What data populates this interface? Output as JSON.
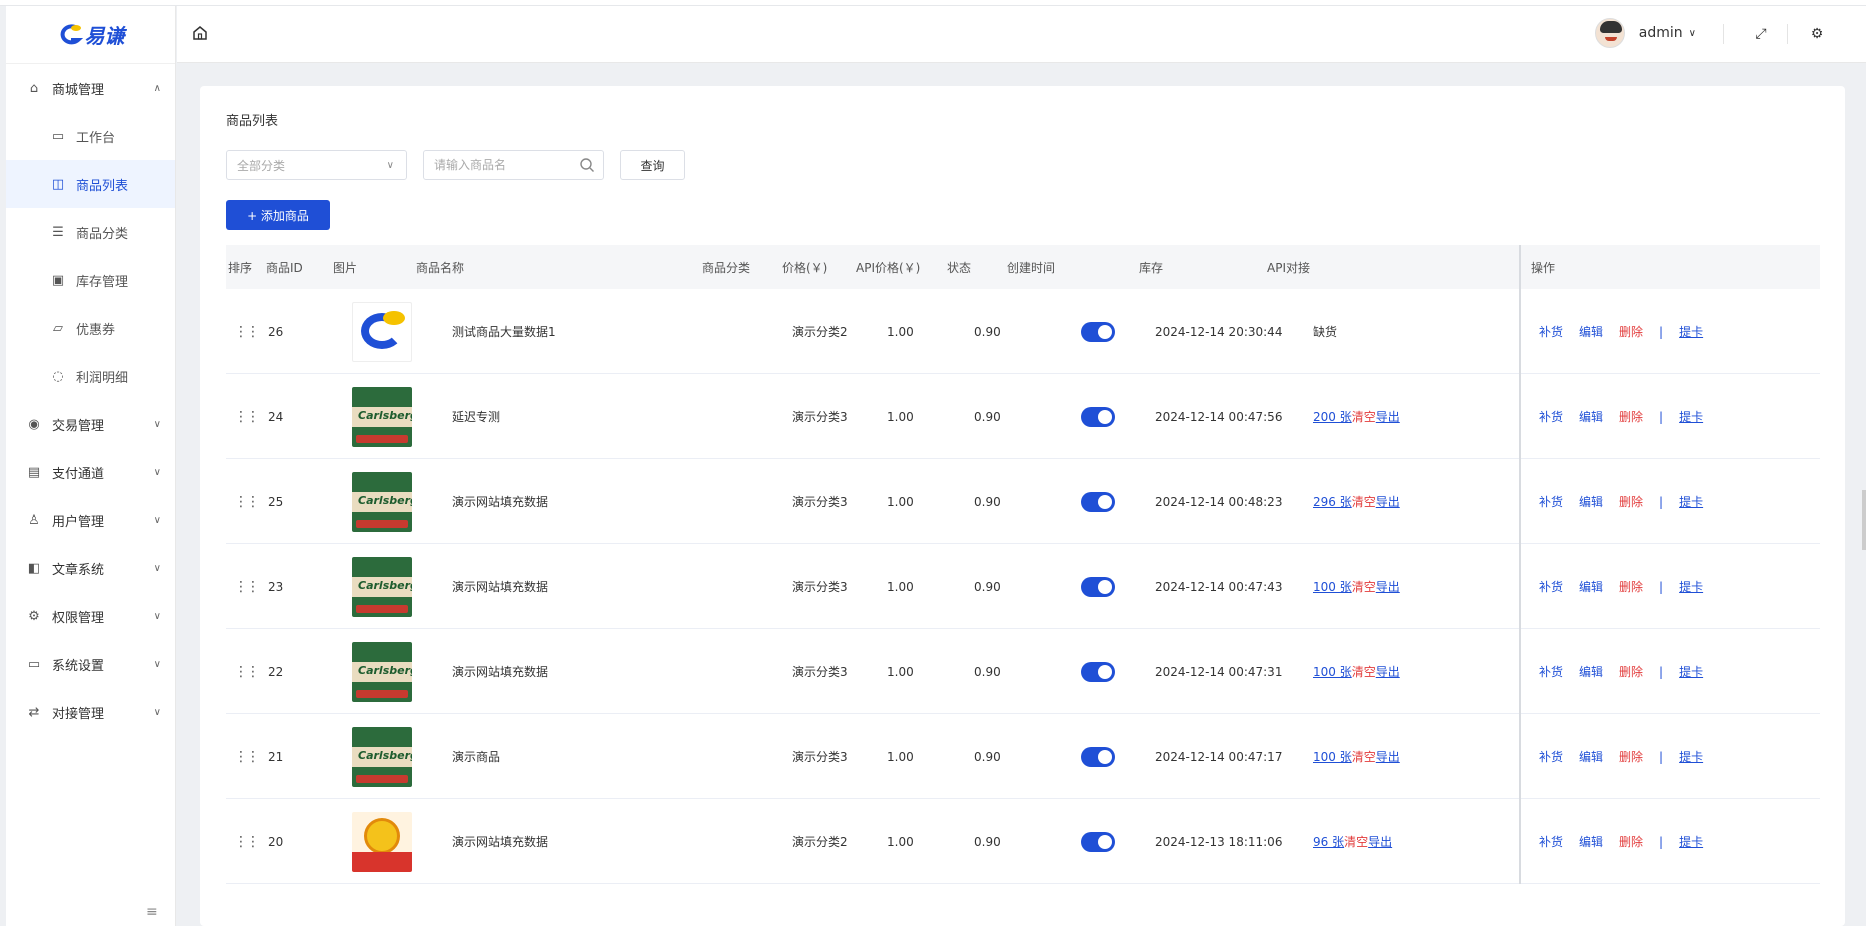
{
  "brand": {
    "logo_text": "易谦"
  },
  "sidebar": {
    "groups": [
      {
        "label": "商城管理",
        "icon": "store-icon",
        "expanded": true,
        "items": [
          {
            "label": "工作台",
            "icon": "monitor-icon",
            "active": false
          },
          {
            "label": "商品列表",
            "icon": "bag-icon",
            "active": true
          },
          {
            "label": "商品分类",
            "icon": "list-icon",
            "active": false
          },
          {
            "label": "库存管理",
            "icon": "inventory-icon",
            "active": false
          },
          {
            "label": "优惠券",
            "icon": "folder-icon",
            "active": false
          },
          {
            "label": "利润明细",
            "icon": "profit-icon",
            "active": false
          }
        ]
      },
      {
        "label": "交易管理",
        "icon": "trade-icon"
      },
      {
        "label": "支付通道",
        "icon": "payment-icon"
      },
      {
        "label": "用户管理",
        "icon": "user-icon"
      },
      {
        "label": "文章系统",
        "icon": "book-icon"
      },
      {
        "label": "权限管理",
        "icon": "gear-icon"
      },
      {
        "label": "系统设置",
        "icon": "settings-monitor-icon"
      },
      {
        "label": "对接管理",
        "icon": "swap-icon"
      }
    ]
  },
  "header": {
    "username": "admin"
  },
  "main": {
    "title": "商品列表",
    "filter": {
      "category_placeholder": "全部分类",
      "search_placeholder": "请输入商品名",
      "query_label": "查询"
    },
    "add_label": "+ 添加商品",
    "columns": [
      "排序",
      "商品ID",
      "图片",
      "商品名称",
      "商品分类",
      "价格(￥)",
      "API价格(￥)",
      "状态",
      "创建时间",
      "库存",
      "API对接",
      "操作"
    ],
    "ops": {
      "restock": "补货",
      "edit": "编辑",
      "delete": "删除",
      "bar": "|",
      "extract": "提卡"
    },
    "stock_labels": {
      "clear": "清空",
      "export": "导出"
    },
    "rows": [
      {
        "id": "26",
        "thumb": "logo",
        "name": "测试商品大量数据1",
        "category": "演示分类2",
        "price": "1.00",
        "api_price": "0.90",
        "enabled": true,
        "created": "2024-12-14 20:30:44",
        "stock": "缺货",
        "out_of_stock": true
      },
      {
        "id": "24",
        "thumb": "beer",
        "name": "延迟专测",
        "category": "演示分类3",
        "price": "1.00",
        "api_price": "0.90",
        "enabled": true,
        "created": "2024-12-14 00:47:56",
        "stock": "200 张"
      },
      {
        "id": "25",
        "thumb": "beer",
        "name": "演示网站填充数据",
        "category": "演示分类3",
        "price": "1.00",
        "api_price": "0.90",
        "enabled": true,
        "created": "2024-12-14 00:48:23",
        "stock": "296 张"
      },
      {
        "id": "23",
        "thumb": "beer",
        "name": "演示网站填充数据",
        "category": "演示分类3",
        "price": "1.00",
        "api_price": "0.90",
        "enabled": true,
        "created": "2024-12-14 00:47:43",
        "stock": "100 张"
      },
      {
        "id": "22",
        "thumb": "beer",
        "name": "演示网站填充数据",
        "category": "演示分类3",
        "price": "1.00",
        "api_price": "0.90",
        "enabled": true,
        "created": "2024-12-14 00:47:31",
        "stock": "100 张"
      },
      {
        "id": "21",
        "thumb": "beer",
        "name": "演示商品",
        "category": "演示分类3",
        "price": "1.00",
        "api_price": "0.90",
        "enabled": true,
        "created": "2024-12-14 00:47:17",
        "stock": "100 张"
      },
      {
        "id": "20",
        "thumb": "monkey",
        "name": "演示网站填充数据",
        "category": "演示分类2",
        "price": "1.00",
        "api_price": "0.90",
        "enabled": true,
        "created": "2024-12-13 18:11:06",
        "stock": "96 张"
      }
    ]
  }
}
